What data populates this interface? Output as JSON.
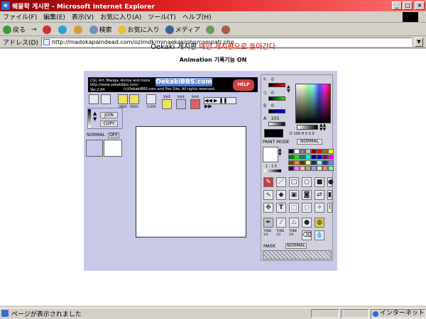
{
  "window": {
    "title": "웨물학 게시판 - Microsoft Internet Explorer",
    "minimize": "_",
    "maximize": "□",
    "close": "×"
  },
  "menu": [
    "ファイル(F)",
    "編集(E)",
    "表示(V)",
    "お気に入り(A)",
    "ツール(T)",
    "ヘルプ(H)"
  ],
  "toolbar": {
    "back": "戻る",
    "forward": "→",
    "stop": "×",
    "search": "検索",
    "favorites": "お気に入り",
    "media": "メディア"
  },
  "address": {
    "label": "アドレス(D)",
    "url": "http://madokapaindead.com/ozimdk/minaekakiphp/compati.php"
  },
  "page": {
    "title_prefix": "Oekaki 게시판",
    "title_link": "메인 게시판으로 돌아간다",
    "animation_line": "Animation 기록기능 ON"
  },
  "applet": {
    "banner_lines": [
      "CGI, Art, Manga, Anime and more",
      "http://www.oekakibbs.com/",
      "Ver.2.64",
      "(c)OekakiBBS.com and Poo Site, All rights reserved."
    ],
    "brand": "OekakiBBS.com",
    "help": "HELP",
    "undo": "UNDO",
    "redo": "REDO",
    "clear": "CLEAR",
    "save": "SAVE",
    "join": "JOIN",
    "copy": "COPY",
    "layer_mode": "NORMAL",
    "layer_state": "OFF",
    "r_label": "R",
    "g_label": "G",
    "b_label": "B",
    "a_label": "A",
    "r_value": "0",
    "g_value": "0",
    "b_value": "0",
    "a_value": "255",
    "v_label": "V",
    "v_value": "100",
    "dhs": "D 100  H 0   S 0",
    "paint_mode_label": "PAINT MODE",
    "paint_mode_value": "NORMAL",
    "brush_scale": "1 : 1.5",
    "tone_labels": [
      "TONE 1/4",
      "TONE 1/2",
      "TONE 3/4"
    ],
    "mask_label": "MASK",
    "mask_value": "NORMAL"
  },
  "palette": [
    "#000000",
    "#ffffff",
    "#808080",
    "#c0c0c0",
    "#800000",
    "#ff0000",
    "#808000",
    "#ffff00",
    "#008000",
    "#00ff00",
    "#008080",
    "#00ffff",
    "#000080",
    "#0000ff",
    "#800080",
    "#ff00ff",
    "#804000",
    "#ff8040",
    "#404000",
    "#ffff80",
    "#004040",
    "#80ffff",
    "#004080",
    "#8080ff",
    "#400040",
    "#ff80ff",
    "#ffc0a0",
    "#c0a080",
    "#a0a0ff",
    "#e0e0e0",
    "#ff8080",
    "#80ff80"
  ],
  "status": {
    "message": "ページが表示されました",
    "zone": "インターネット"
  }
}
